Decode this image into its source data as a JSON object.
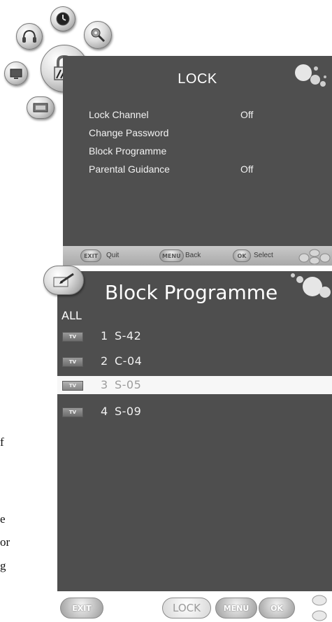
{
  "lock_menu": {
    "title": "LOCK",
    "items": [
      {
        "label": "Lock Channel",
        "value": "Off"
      },
      {
        "label": "Change Password",
        "value": ""
      },
      {
        "label": "Block Programme",
        "value": ""
      },
      {
        "label": "Parental Guidance",
        "value": "Off"
      }
    ],
    "footer": {
      "exit_button": "EXIT",
      "exit_label": "Quit",
      "menu_button": "MENU",
      "menu_label": "Back",
      "ok_button": "OK",
      "ok_label": "Select"
    }
  },
  "block_programme": {
    "title": "Block Programme",
    "all_label": "ALL",
    "channels": [
      {
        "badge": "TV",
        "number": "1",
        "name": "S-42",
        "selected": false
      },
      {
        "badge": "TV",
        "number": "2",
        "name": "C-04",
        "selected": false
      },
      {
        "badge": "TV",
        "number": "3",
        "name": "S-05",
        "selected": true
      },
      {
        "badge": "TV",
        "number": "4",
        "name": "S-09",
        "selected": false
      }
    ]
  },
  "bottom_bar": {
    "exit_button": "EXIT",
    "lock_button": "LOCK",
    "menu_button": "MENU",
    "ok_button": "OK"
  },
  "side_fragments": [
    "f",
    "e",
    "or",
    "g"
  ],
  "icons": [
    "clock-icon",
    "tools-icon",
    "audio-icon",
    "lock-icon",
    "picture-icon",
    "tv-icon",
    "edit-icon",
    "bubbles-icon"
  ],
  "colors": {
    "panel": "#4f4f4f",
    "footer": "#b5b5b5",
    "selected_row": "#f7f7f7"
  }
}
